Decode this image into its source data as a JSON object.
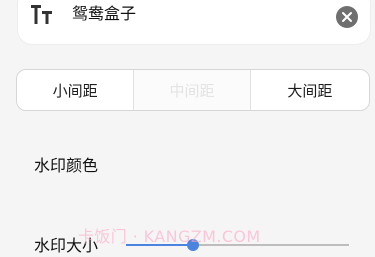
{
  "text_input": {
    "value": "鸳鸯盒子",
    "leading_icon": "text-size-icon",
    "clear_icon": "clear-icon"
  },
  "spacing": {
    "options": [
      {
        "label": "小间距"
      },
      {
        "label": "中间距"
      },
      {
        "label": "大间距"
      }
    ]
  },
  "watermark": {
    "color_label": "水印颜色",
    "size_label": "水印大小",
    "size_value": 0.3,
    "accent_color": "#4a84df"
  },
  "page_watermark": {
    "text": "卡饭门 · KANGZM.COM"
  }
}
